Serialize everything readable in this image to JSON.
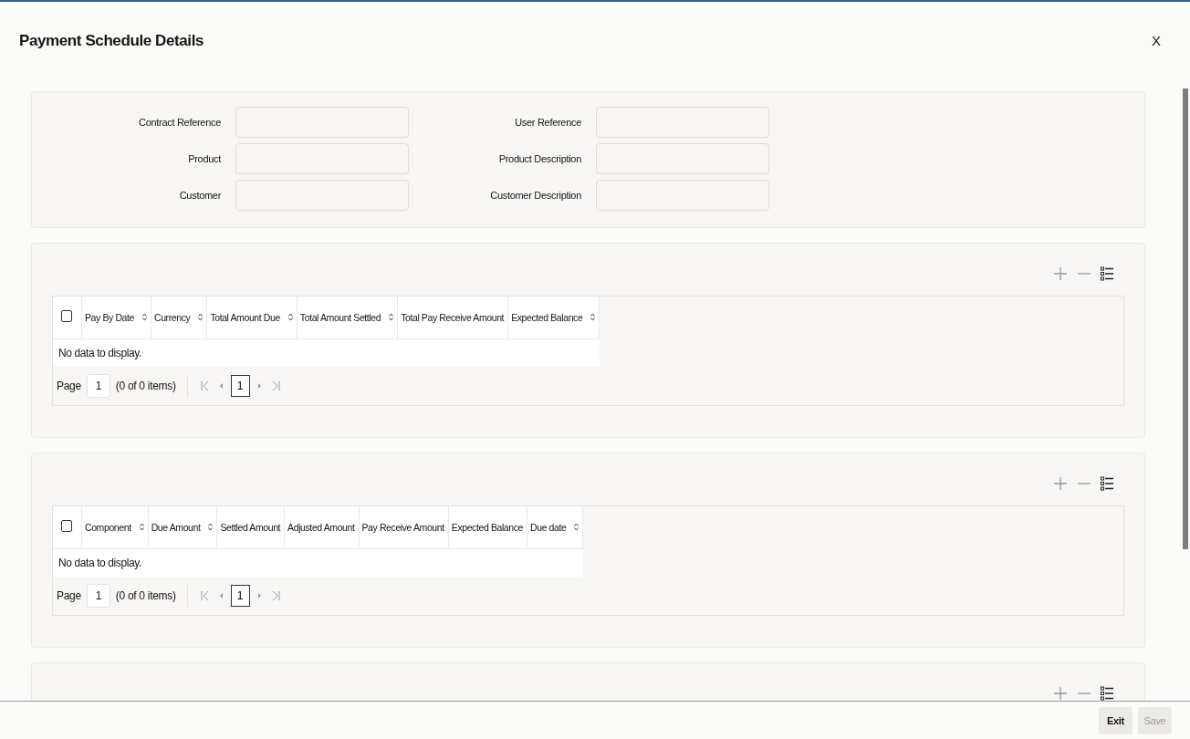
{
  "window": {
    "title": "Payment Schedule Details",
    "close": "X"
  },
  "fields": [
    {
      "label": "Contract Reference"
    },
    {
      "label": "User Reference"
    },
    {
      "label": "Product"
    },
    {
      "label": "Product Description"
    },
    {
      "label": "Customer"
    },
    {
      "label": "Customer Description"
    }
  ],
  "grids": [
    {
      "toolbar": true,
      "select_all": {
        "checked": false
      },
      "columns": [
        {
          "label": "Pay By Date",
          "sortable": true
        },
        {
          "label": "Currency",
          "sortable": true
        },
        {
          "label": "Total Amount Due",
          "sortable": true
        },
        {
          "label": "Total Amount Settled",
          "sortable": true
        },
        {
          "label": "Total Pay Receive Amount",
          "sortable": false
        },
        {
          "label": "Expected Balance",
          "sortable": true
        }
      ],
      "empty_text": "No data to display.",
      "pager": {
        "label": "Page",
        "page": "1",
        "summary": "(0 of 0 items)",
        "current": "1"
      }
    },
    {
      "toolbar": true,
      "select_all": {
        "checked": false
      },
      "columns": [
        {
          "label": "Component",
          "sortable": true
        },
        {
          "label": "Due Amount",
          "sortable": true
        },
        {
          "label": "Settled Amount",
          "sortable": false
        },
        {
          "label": "Adjusted Amount",
          "sortable": false
        },
        {
          "label": "Pay Receive Amount",
          "sortable": false
        },
        {
          "label": "Expected Balance",
          "sortable": false
        },
        {
          "label": "Due date",
          "sortable": true
        }
      ],
      "empty_text": "No data to display.",
      "pager": {
        "label": "Page",
        "page": "1",
        "summary": "(0 of 0 items)",
        "current": "1"
      }
    },
    {
      "toolbar": true
    }
  ],
  "buttons": [
    {
      "label": "Exit",
      "disabled": false
    },
    {
      "label": "Save",
      "disabled": true
    }
  ]
}
